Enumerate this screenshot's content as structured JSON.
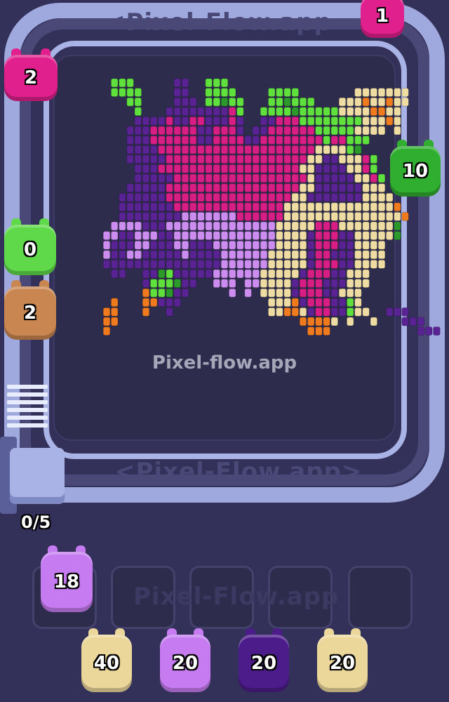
{
  "app": {
    "watermark_top": "<Pixel-Flow.app",
    "watermark_bottom": "<Pixel-Flow.app>",
    "watermark_center": "Pixel-flow.app",
    "watermark_slots": "Pixel-Flow.app"
  },
  "conveyor": {
    "pigs": [
      {
        "id": "belt-pig-top-right",
        "count": "1",
        "color": "#e0208c"
      },
      {
        "id": "belt-pig-left-top",
        "count": "2",
        "color": "#e0208c"
      },
      {
        "id": "belt-pig-right",
        "count": "10",
        "color": "#2fae2f"
      },
      {
        "id": "belt-pig-left-green",
        "count": "0",
        "color": "#5fd94a"
      },
      {
        "id": "belt-pig-left-tan",
        "count": "2",
        "color": "#c98650"
      }
    ]
  },
  "queue": {
    "counter": "0/5",
    "active_pig": {
      "count": "18",
      "color": "#c67cf0"
    },
    "waiting_pigs": [
      {
        "count": "40",
        "color": "#ecd79a"
      },
      {
        "count": "20",
        "color": "#c67cf0"
      },
      {
        "count": "20",
        "color": "#4c1d8a"
      },
      {
        "count": "20",
        "color": "#ecd79a"
      }
    ],
    "slots_total": 5
  },
  "palette": {
    "board_bg": "#2e2c4c",
    "belt": "#9fa9de",
    "pixel_magenta": "#d81e84",
    "pixel_purple": "#5a2393",
    "pixel_lilac": "#cd8cf0",
    "pixel_cream": "#eedca3",
    "pixel_green": "#5fe03c",
    "pixel_dark_green": "#2b9a2b",
    "pixel_orange": "#f07a1e"
  }
}
